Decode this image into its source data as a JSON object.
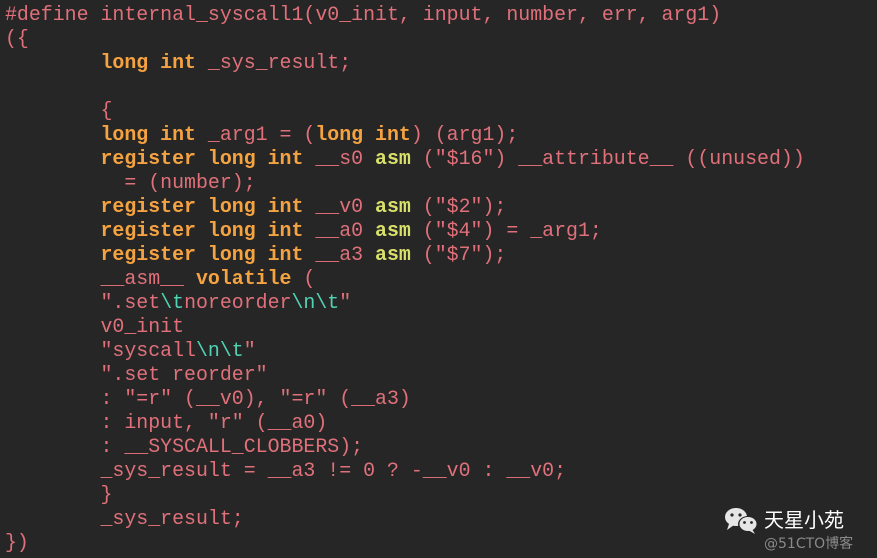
{
  "code": {
    "language": "c",
    "lines": [
      [
        {
          "t": "#define internal_syscall1(v0_init, input, number, err, arg1)",
          "c": "pl"
        }
      ],
      [
        {
          "t": "({",
          "c": "pl"
        }
      ],
      [
        {
          "t": "        ",
          "c": "pl"
        },
        {
          "t": "long int",
          "c": "kw"
        },
        {
          "t": " _sys_result;",
          "c": "pl"
        }
      ],
      [
        {
          "t": "",
          "c": "pl"
        }
      ],
      [
        {
          "t": "        {",
          "c": "pl"
        }
      ],
      [
        {
          "t": "        ",
          "c": "pl"
        },
        {
          "t": "long int",
          "c": "kw"
        },
        {
          "t": " _arg1 = (",
          "c": "pl"
        },
        {
          "t": "long int",
          "c": "kw"
        },
        {
          "t": ") (arg1);",
          "c": "pl"
        }
      ],
      [
        {
          "t": "        ",
          "c": "pl"
        },
        {
          "t": "register long int",
          "c": "kw"
        },
        {
          "t": " __s0 ",
          "c": "pl"
        },
        {
          "t": "asm",
          "c": "asm"
        },
        {
          "t": " (\"$16\") __attribute__ ((unused))",
          "c": "pl"
        }
      ],
      [
        {
          "t": "          = (number);",
          "c": "pl"
        }
      ],
      [
        {
          "t": "        ",
          "c": "pl"
        },
        {
          "t": "register long int",
          "c": "kw"
        },
        {
          "t": " __v0 ",
          "c": "pl"
        },
        {
          "t": "asm",
          "c": "asm"
        },
        {
          "t": " (\"$2\");",
          "c": "pl"
        }
      ],
      [
        {
          "t": "        ",
          "c": "pl"
        },
        {
          "t": "register long int",
          "c": "kw"
        },
        {
          "t": " __a0 ",
          "c": "pl"
        },
        {
          "t": "asm",
          "c": "asm"
        },
        {
          "t": " (\"$4\") = _arg1;",
          "c": "pl"
        }
      ],
      [
        {
          "t": "        ",
          "c": "pl"
        },
        {
          "t": "register long int",
          "c": "kw"
        },
        {
          "t": " __a3 ",
          "c": "pl"
        },
        {
          "t": "asm",
          "c": "asm"
        },
        {
          "t": " (\"$7\");",
          "c": "pl"
        }
      ],
      [
        {
          "t": "        __asm__ ",
          "c": "pl"
        },
        {
          "t": "volatile",
          "c": "kw"
        },
        {
          "t": " (",
          "c": "pl"
        }
      ],
      [
        {
          "t": "        \".set",
          "c": "pl"
        },
        {
          "t": "\\t",
          "c": "esc"
        },
        {
          "t": "noreorder",
          "c": "pl"
        },
        {
          "t": "\\n\\t",
          "c": "esc"
        },
        {
          "t": "\"",
          "c": "pl"
        }
      ],
      [
        {
          "t": "        v0_init",
          "c": "pl"
        }
      ],
      [
        {
          "t": "        \"syscall",
          "c": "pl"
        },
        {
          "t": "\\n\\t",
          "c": "esc"
        },
        {
          "t": "\"",
          "c": "pl"
        }
      ],
      [
        {
          "t": "        \".set reorder\"",
          "c": "pl"
        }
      ],
      [
        {
          "t": "        : \"=r\" (__v0), \"=r\" (__a3)",
          "c": "pl"
        }
      ],
      [
        {
          "t": "        : input, \"r\" (__a0)",
          "c": "pl"
        }
      ],
      [
        {
          "t": "        : __SYSCALL_CLOBBERS);",
          "c": "pl"
        }
      ],
      [
        {
          "t": "        _sys_result = __a3 != 0 ? -__v0 : __v0;",
          "c": "pl"
        }
      ],
      [
        {
          "t": "        }",
          "c": "pl"
        }
      ],
      [
        {
          "t": "        _sys_result;",
          "c": "pl"
        }
      ],
      [
        {
          "t": "})",
          "c": "pl"
        }
      ]
    ]
  },
  "watermark": {
    "icon": "wechat-icon",
    "title": "天星小苑",
    "subtitle": "@51CTO博客"
  },
  "colors": {
    "background": "#262626",
    "plain": "#e0707a",
    "keyword": "#f5a341",
    "asm_keyword": "#d8e06a",
    "escape": "#4fd3b4"
  }
}
